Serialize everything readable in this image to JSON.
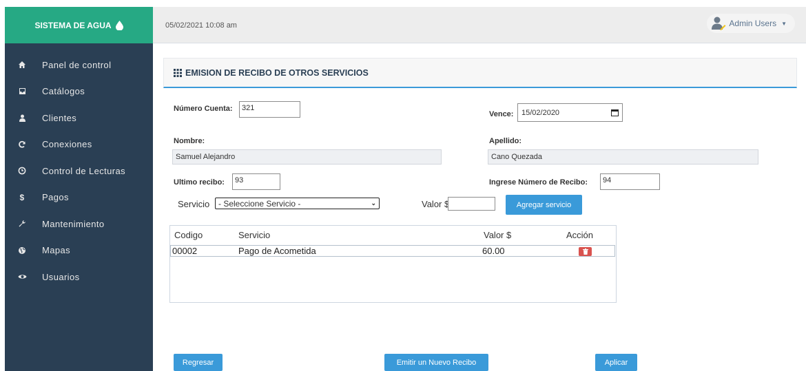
{
  "sidebar": {
    "brand": "SISTEMA DE AGUA",
    "items": [
      {
        "label": "Panel de control",
        "icon": "home-icon"
      },
      {
        "label": "Catálogos",
        "icon": "inbox-icon"
      },
      {
        "label": "Clientes",
        "icon": "user-icon"
      },
      {
        "label": "Conexiones",
        "icon": "refresh-icon"
      },
      {
        "label": "Control de Lecturas",
        "icon": "clock-icon"
      },
      {
        "label": "Pagos",
        "icon": "dollar-icon"
      },
      {
        "label": "Mantenimiento",
        "icon": "wrench-icon"
      },
      {
        "label": "Mapas",
        "icon": "globe-icon"
      },
      {
        "label": "Usuarios",
        "icon": "eye-icon"
      }
    ]
  },
  "header": {
    "datetime": "05/02/2021 10:08 am",
    "user": "Admin Users"
  },
  "panel": {
    "title": "EMISION DE RECIBO DE OTROS SERVICIOS"
  },
  "form": {
    "cuenta_label": "Número Cuenta:",
    "cuenta_value": "321",
    "vence_label": "Vence:",
    "vence_value": "15/02/2020",
    "nombre_label": "Nombre:",
    "nombre_value": "Samuel Alejandro",
    "apellido_label": "Apellido:",
    "apellido_value": "Cano Quezada",
    "ultimo_label": "Ultimo recibo:",
    "ultimo_value": "93",
    "ingrese_label": "Ingrese Número de Recibo:",
    "ingrese_value": "94",
    "servicio_label": "Servicio",
    "servicio_selected": "- Seleccione Servicio -",
    "valor_label": "Valor $ :",
    "agregar_label": "Agregar servicio"
  },
  "table": {
    "headers": [
      "Codigo",
      "Servicio",
      "Valor $",
      "Acción"
    ],
    "rows": [
      {
        "codigo": "00002",
        "servicio": "Pago de Acometida",
        "valor": "60.00"
      }
    ]
  },
  "footer": {
    "regresar": "Regresar",
    "emitir": "Emitir un Nuevo Recibo",
    "aplicar": "Aplicar"
  },
  "colors": {
    "sidebar": "#2a3f54",
    "brand": "#26a984",
    "primary_button": "#3a9ad9",
    "delete_button": "#d9534f"
  }
}
